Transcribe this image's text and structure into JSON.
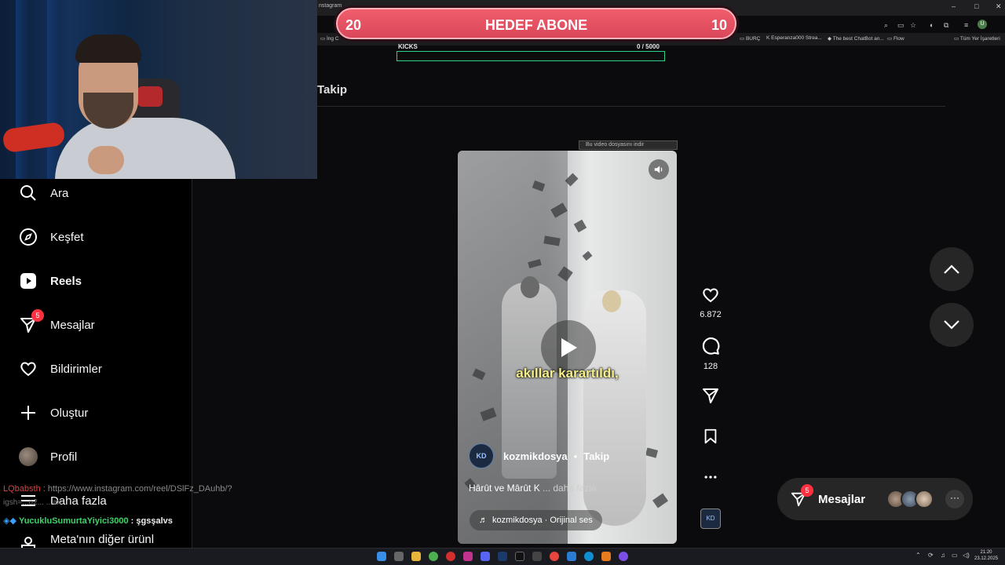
{
  "browser": {
    "tab_title": "nstagram",
    "bookmarks_left": [
      "İng C"
    ],
    "bookmarks_right": [
      "BURÇ",
      "Esperanza000 Strea...",
      "The best ChatBot an...",
      "Flow",
      "Tüm Yer İşaretleri"
    ],
    "profile_initial": "U"
  },
  "overlay": {
    "banner_left": "20",
    "banner_title": "HEDEF ABONE",
    "banner_right": "10",
    "kicks_label": "KICKS",
    "kicks_count": "0  / 5000",
    "kicks_progress": 0
  },
  "header": {
    "follow_partial": "Takip"
  },
  "sidebar": {
    "items": [
      {
        "label": "Ara",
        "icon": "search-icon"
      },
      {
        "label": "Keşfet",
        "icon": "compass-icon"
      },
      {
        "label": "Reels",
        "icon": "reels-icon"
      },
      {
        "label": "Mesajlar",
        "icon": "messenger-icon",
        "badge": "5"
      },
      {
        "label": "Bildirimler",
        "icon": "heart-icon"
      },
      {
        "label": "Oluştur",
        "icon": "plus-icon"
      },
      {
        "label": "Profil",
        "icon": "avatar"
      },
      {
        "label": "Daha fazla",
        "icon": "menu-icon"
      },
      {
        "label": "Meta'nın diğer ürünl",
        "icon": "meta-icon"
      }
    ]
  },
  "chat": {
    "line1_user": "LQbabsth",
    "line1_msg": ": https://www.instagram.com/reel/DSlFz_DAuhb/?",
    "line1b": "igsh=...o2... ...ax",
    "line2_user": "YucukluSumurtaYiyici3000",
    "line2_msg": ": şgsşalvs"
  },
  "reel": {
    "topbar_text": "Bu video dosyasını indir",
    "caption": "akıllar karartıldı,",
    "author": "kozmikdosya",
    "follow_label": "Takip",
    "description": "Hârût ve Mârût K",
    "more_label": "... daha fazla",
    "audio": "kozmikdosya · Orijinal ses",
    "avatar_text": "KD"
  },
  "actions": {
    "likes": "6.872",
    "comments": "128"
  },
  "dock": {
    "label": "Mesajlar",
    "badge": "5",
    "more": "···"
  },
  "taskbar": {
    "time": "21:20",
    "date": "23.12.2025"
  }
}
